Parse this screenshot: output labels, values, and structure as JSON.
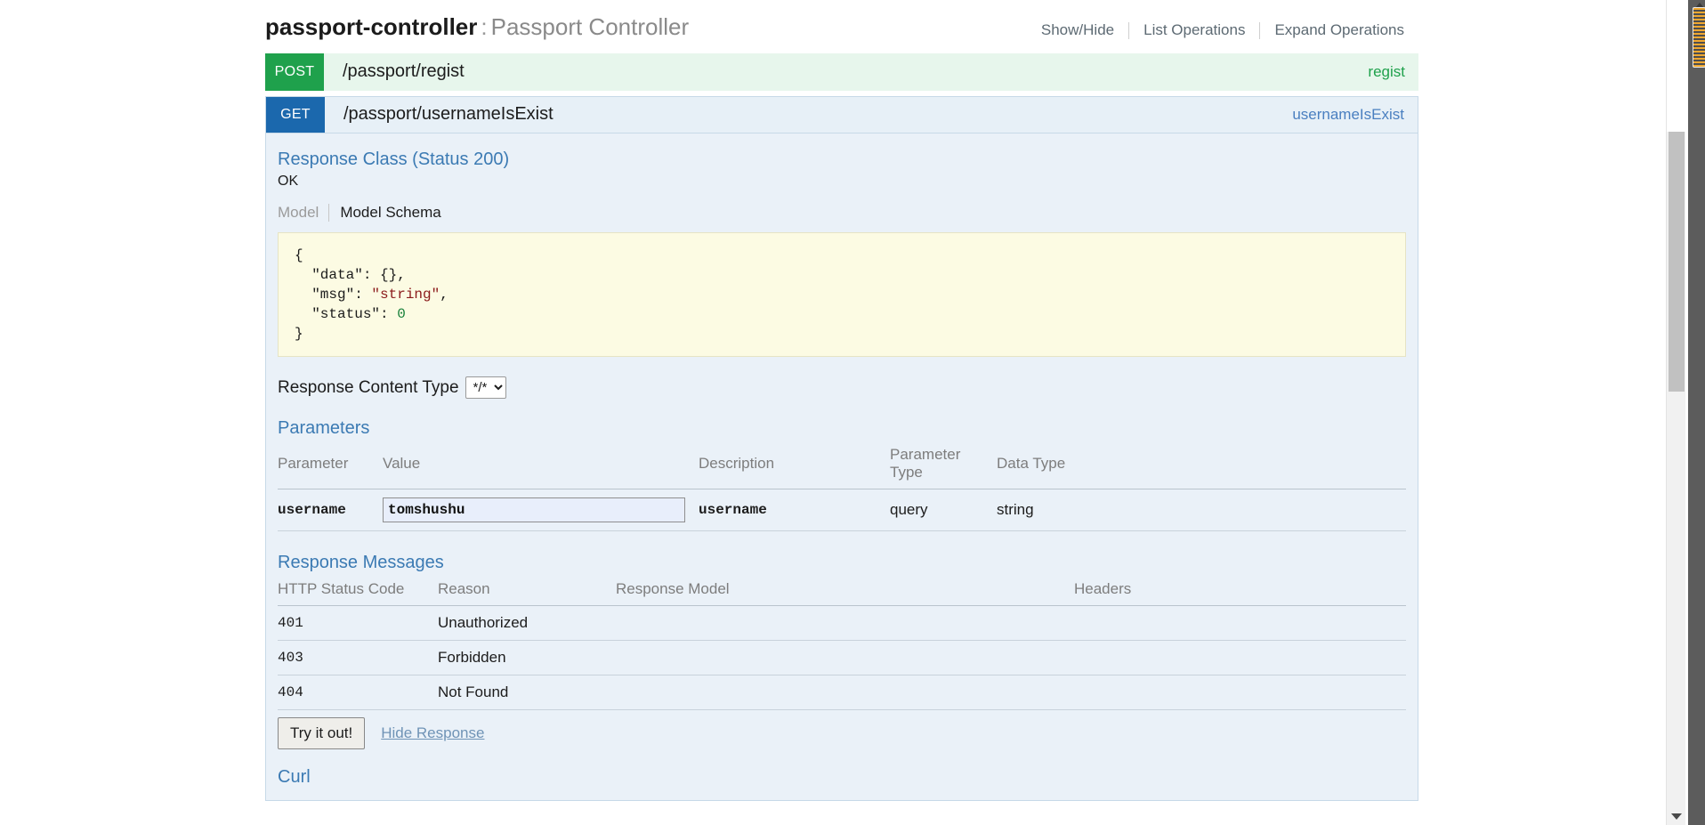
{
  "resource": {
    "name": "passport-controller",
    "separator": ":",
    "description": "Passport Controller",
    "options": {
      "show_hide": "Show/Hide",
      "list_operations": "List Operations",
      "expand_operations": "Expand Operations"
    }
  },
  "endpoints": [
    {
      "method": "POST",
      "path": "/passport/regist",
      "summary": "regist",
      "expanded": false
    },
    {
      "method": "GET",
      "path": "/passport/usernameIsExist",
      "summary": "usernameIsExist",
      "expanded": true
    }
  ],
  "detail": {
    "response_class_heading": "Response Class (Status 200)",
    "response_class_status": "OK",
    "model_tab": "Model",
    "model_schema_tab": "Model Schema",
    "schema_lines": {
      "l1": "{",
      "l2_key": "  \"data\": {},",
      "l3_key": "  \"msg\": ",
      "l3_val": "\"string\"",
      "l3_end": ",",
      "l4_key": "  \"status\": ",
      "l4_val": "0",
      "l5": "}"
    },
    "content_type_label": "Response Content Type",
    "content_type_value": "*/*",
    "content_type_options": [
      "*/*"
    ],
    "parameters": {
      "heading": "Parameters",
      "columns": [
        "Parameter",
        "Value",
        "Description",
        "Parameter Type",
        "Data Type"
      ],
      "rows": [
        {
          "parameter": "username",
          "value": "tomshushu",
          "placeholder": "",
          "description": "username",
          "parameter_type": "query",
          "data_type": "string"
        }
      ]
    },
    "response_messages": {
      "heading": "Response Messages",
      "columns": [
        "HTTP Status Code",
        "Reason",
        "Response Model",
        "Headers"
      ],
      "rows": [
        {
          "code": "401",
          "reason": "Unauthorized",
          "model": "",
          "headers": ""
        },
        {
          "code": "403",
          "reason": "Forbidden",
          "model": "",
          "headers": ""
        },
        {
          "code": "404",
          "reason": "Not Found",
          "model": "",
          "headers": ""
        }
      ]
    },
    "try_button": "Try it out!",
    "hide_response": "Hide Response",
    "curl_heading": "Curl"
  },
  "colors": {
    "post_green": "#1fa14c",
    "get_blue": "#1b68ad",
    "heading_blue": "#3b7ab3",
    "panel_bg": "#eaf1f8",
    "schema_bg": "#fcfbe3",
    "scrollbar_orange": "#f0a830"
  }
}
